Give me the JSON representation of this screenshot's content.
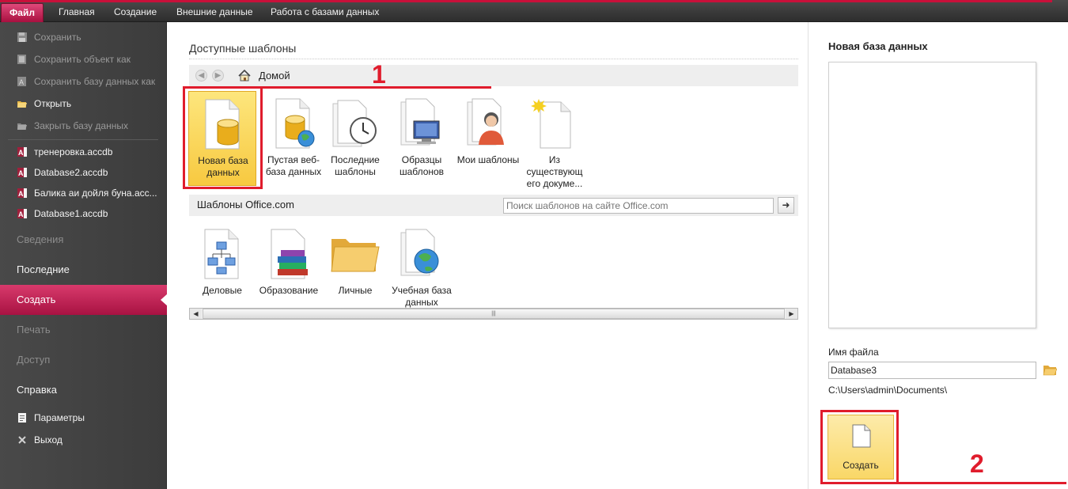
{
  "ribbon": {
    "tabs": [
      "Файл",
      "Главная",
      "Создание",
      "Внешние данные",
      "Работа с базами данных"
    ]
  },
  "leftnav": {
    "commands": [
      {
        "label": "Сохранить",
        "enabled": false
      },
      {
        "label": "Сохранить объект как",
        "enabled": false
      },
      {
        "label": "Сохранить базу данных как",
        "enabled": false
      },
      {
        "label": "Открыть",
        "enabled": true
      },
      {
        "label": "Закрыть базу данных",
        "enabled": false
      }
    ],
    "recent": [
      "тренеровка.accdb",
      "Database2.accdb",
      "Балика аи дойля буна.acc...",
      "Database1.accdb"
    ],
    "sections": [
      {
        "label": "Сведения",
        "state": "disabled"
      },
      {
        "label": "Последние",
        "state": "enabled"
      },
      {
        "label": "Создать",
        "state": "active"
      },
      {
        "label": "Печать",
        "state": "disabled"
      },
      {
        "label": "Доступ",
        "state": "disabled"
      },
      {
        "label": "Справка",
        "state": "enabled"
      }
    ],
    "bottom": [
      "Параметры",
      "Выход"
    ]
  },
  "templates": {
    "title": "Доступные шаблоны",
    "home_label": "Домой",
    "items": [
      {
        "label": "Новая база данных",
        "icon": "database-icon"
      },
      {
        "label": "Пустая веб-база данных",
        "icon": "web-database-icon"
      },
      {
        "label": "Последние шаблоны",
        "icon": "clock-icon"
      },
      {
        "label": "Образцы шаблонов",
        "icon": "computer-icon"
      },
      {
        "label": "Мои шаблоны",
        "icon": "person-icon"
      },
      {
        "label": "Из существующ его докуме...",
        "icon": "new-document-icon"
      }
    ]
  },
  "office": {
    "title": "Шаблоны Office.com",
    "search_placeholder": "Поиск шаблонов на сайте Office.com",
    "items": [
      {
        "label": "Деловые",
        "icon": "org-chart-icon"
      },
      {
        "label": "Образование",
        "icon": "books-icon"
      },
      {
        "label": "Личные",
        "icon": "folder-icon"
      },
      {
        "label": "Учебная база данных",
        "icon": "globe-icon"
      }
    ]
  },
  "right": {
    "title": "Новая база данных",
    "filename_label": "Имя файла",
    "filename": "Database3",
    "path": "C:\\Users\\admin\\Documents\\",
    "create_label": "Создать"
  },
  "annotations": {
    "marker1": "1",
    "marker2": "2"
  },
  "colors": {
    "accent": "#c8103a",
    "highlight": "#e01c2c",
    "selected_tile": "#f7c940"
  }
}
